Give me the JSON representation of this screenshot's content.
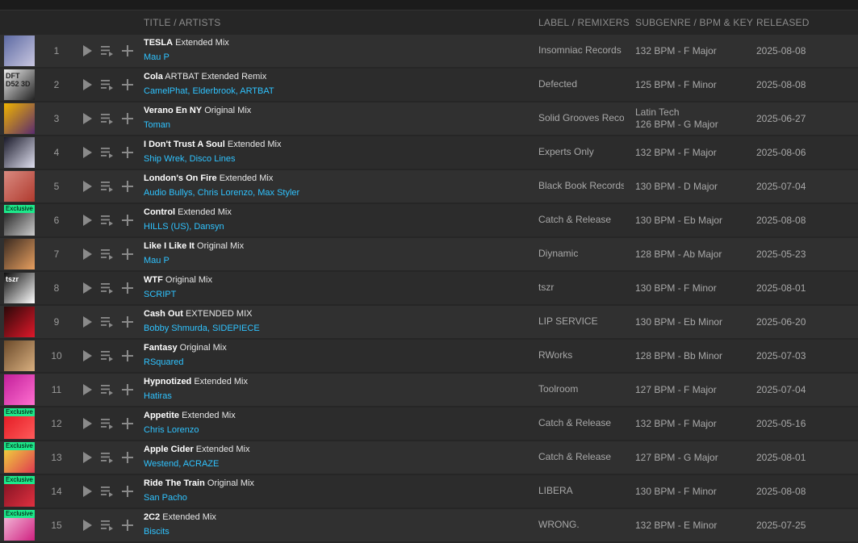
{
  "header": {
    "title": "TITLE / ARTISTS",
    "label": "LABEL / REMIXERS",
    "subgenre": "SUBGENRE / BPM & KEY",
    "released": "RELEASED"
  },
  "icons": {
    "play": "play-icon",
    "queue": "add-to-queue-icon",
    "add": "plus-icon"
  },
  "exclusive_label": "Exclusive",
  "tracks": [
    {
      "num": "1",
      "title": "TESLA",
      "mix": "Extended Mix",
      "artists": "Mau P",
      "label": "Insomniac Records",
      "subgenre": "",
      "bpm_key": "132 BPM - F Major",
      "released": "2025-08-08",
      "exclusive": false,
      "art_colors": [
        "#5d6aa3",
        "#c9c7e0"
      ]
    },
    {
      "num": "2",
      "title": "Cola",
      "mix": "ARTBAT Extended Remix",
      "artists": "CamelPhat, Elderbrook, ARTBAT",
      "label": "Defected",
      "subgenre": "",
      "bpm_key": "125 BPM - F Minor",
      "released": "2025-08-08",
      "exclusive": false,
      "art_colors": [
        "#eeeeee",
        "#222222"
      ],
      "art_text": "DFT D52 3D"
    },
    {
      "num": "3",
      "title": "Verano En NY",
      "mix": "Original Mix",
      "artists": "Toman",
      "label": "Solid Grooves Records",
      "subgenre": "Latin Tech",
      "bpm_key": "126 BPM - G Major",
      "released": "2025-06-27",
      "exclusive": false,
      "art_colors": [
        "#f0b400",
        "#5a2b6e"
      ]
    },
    {
      "num": "4",
      "title": "I Don't Trust A Soul",
      "mix": "Extended Mix",
      "artists": "Ship Wrek, Disco Lines",
      "label": "Experts Only",
      "subgenre": "",
      "bpm_key": "132 BPM - F Major",
      "released": "2025-08-06",
      "exclusive": false,
      "art_colors": [
        "#1a1a2a",
        "#e0e0f0"
      ]
    },
    {
      "num": "5",
      "title": "London's On Fire",
      "mix": "Extended Mix",
      "artists": "Audio Bullys, Chris Lorenzo, Max Styler",
      "label": "Black Book Records",
      "subgenre": "",
      "bpm_key": "130 BPM - D Major",
      "released": "2025-07-04",
      "exclusive": false,
      "art_colors": [
        "#d98a80",
        "#b03a2e"
      ]
    },
    {
      "num": "6",
      "title": "Control",
      "mix": "Extended Mix",
      "artists": "HILLS (US), Dansyn",
      "label": "Catch & Release",
      "subgenre": "",
      "bpm_key": "130 BPM - Eb Major",
      "released": "2025-08-08",
      "exclusive": true,
      "art_colors": [
        "#111111",
        "#cccccc"
      ]
    },
    {
      "num": "7",
      "title": "Like I Like It",
      "mix": "Original Mix",
      "artists": "Mau P",
      "label": "Diynamic",
      "subgenre": "",
      "bpm_key": "128 BPM - Ab Major",
      "released": "2025-05-23",
      "exclusive": false,
      "art_colors": [
        "#3a2a20",
        "#e8a060"
      ]
    },
    {
      "num": "8",
      "title": "WTF",
      "mix": "Original Mix",
      "artists": "SCRIPT",
      "label": "tszr",
      "subgenre": "",
      "bpm_key": "130 BPM - F Minor",
      "released": "2025-08-01",
      "exclusive": false,
      "art_colors": [
        "#0d0d0d",
        "#ffffff"
      ],
      "art_text": "tszr"
    },
    {
      "num": "9",
      "title": "Cash Out",
      "mix": "EXTENDED MIX",
      "artists": "Bobby Shmurda, SIDEPIECE",
      "label": "LIP SERVICE",
      "subgenre": "",
      "bpm_key": "130 BPM - Eb Minor",
      "released": "2025-06-20",
      "exclusive": false,
      "art_colors": [
        "#2a0808",
        "#e0182a"
      ]
    },
    {
      "num": "10",
      "title": "Fantasy",
      "mix": "Original Mix",
      "artists": "RSquared",
      "label": "RWorks",
      "subgenre": "",
      "bpm_key": "128 BPM - Bb Minor",
      "released": "2025-07-03",
      "exclusive": false,
      "art_colors": [
        "#6b4a2a",
        "#d9b080"
      ]
    },
    {
      "num": "11",
      "title": "Hypnotized",
      "mix": "Extended Mix",
      "artists": "Hatiras",
      "label": "Toolroom",
      "subgenre": "",
      "bpm_key": "127 BPM - F Major",
      "released": "2025-07-04",
      "exclusive": false,
      "art_colors": [
        "#c21f9a",
        "#ff6fd0"
      ]
    },
    {
      "num": "12",
      "title": "Appetite",
      "mix": "Extended Mix",
      "artists": "Chris Lorenzo",
      "label": "Catch & Release",
      "subgenre": "",
      "bpm_key": "132 BPM - F Major",
      "released": "2025-05-16",
      "exclusive": true,
      "art_colors": [
        "#e0141e",
        "#ff5a5a"
      ]
    },
    {
      "num": "13",
      "title": "Apple Cider",
      "mix": "Extended Mix",
      "artists": "Westend, ACRAZE",
      "label": "Catch & Release",
      "subgenre": "",
      "bpm_key": "127 BPM - G Major",
      "released": "2025-08-01",
      "exclusive": true,
      "art_colors": [
        "#f2e23a",
        "#e03a50"
      ]
    },
    {
      "num": "14",
      "title": "Ride The Train",
      "mix": "Original Mix",
      "artists": "San Pacho",
      "label": "LIBERA",
      "subgenre": "",
      "bpm_key": "130 BPM - F Minor",
      "released": "2025-08-08",
      "exclusive": true,
      "art_colors": [
        "#7a1020",
        "#e03040"
      ]
    },
    {
      "num": "15",
      "title": "2C2",
      "mix": "Extended Mix",
      "artists": "Biscits",
      "label": "WRONG.",
      "subgenre": "",
      "bpm_key": "132 BPM - E Minor",
      "released": "2025-07-25",
      "exclusive": true,
      "art_colors": [
        "#f5c8e0",
        "#d02080"
      ]
    }
  ]
}
